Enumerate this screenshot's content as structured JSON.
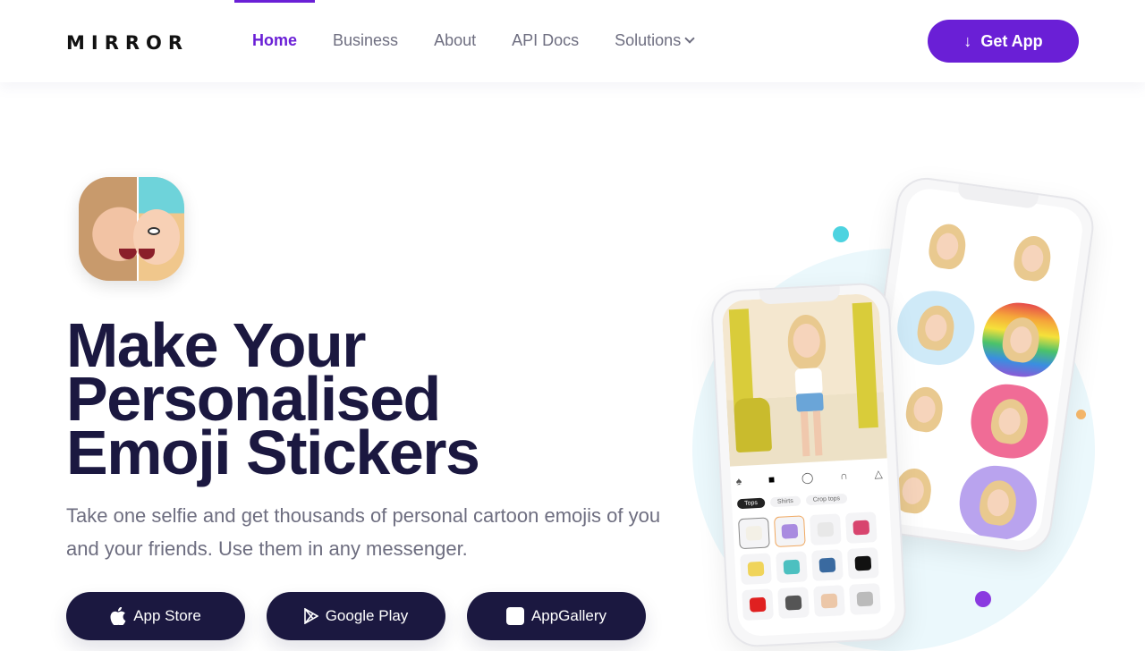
{
  "header": {
    "logo": "MIRROR",
    "nav": [
      {
        "label": "Home",
        "active": true
      },
      {
        "label": "Business",
        "active": false
      },
      {
        "label": "About",
        "active": false
      },
      {
        "label": "API Docs",
        "active": false
      },
      {
        "label": "Solutions",
        "active": false,
        "has_dropdown": true
      }
    ],
    "cta": {
      "label": "Get App",
      "icon": "download-arrow-icon"
    }
  },
  "hero": {
    "app_icon": "mirror-app-icon",
    "headline": [
      "Make Your",
      "Personalised",
      "Emoji Stickers"
    ],
    "subtitle": "Take one selfie and get thousands of personal cartoon emojis of you and your friends. Use them in any messenger.",
    "stores": [
      {
        "label": "App Store",
        "icon": "apple-icon"
      },
      {
        "label": "Google Play",
        "icon": "google-play-icon"
      },
      {
        "label": "AppGallery",
        "icon": "huawei-icon"
      }
    ]
  },
  "phone_mockup": {
    "wardrobe_chips": [
      "Tops",
      "Shirts",
      "Crop tops"
    ],
    "wardrobe_tabs": [
      "avatar",
      "tops",
      "jackets",
      "pants",
      "dresses"
    ]
  },
  "colors": {
    "accent": "#6a1fd6",
    "dark": "#1b1840",
    "muted_text": "#6e6e80",
    "blob": "#ebf8fc",
    "dot_cyan": "#4dd3e0",
    "dot_orange": "#f5b76a",
    "dot_purple": "#8a3ae0"
  }
}
